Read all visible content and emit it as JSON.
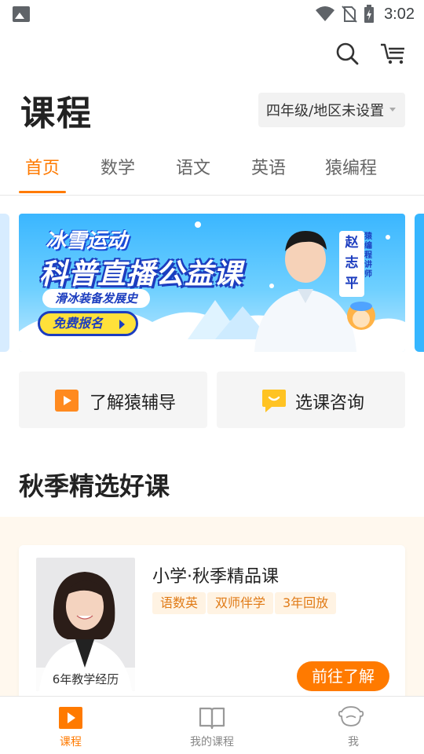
{
  "status_bar": {
    "time": "3:02",
    "icons": [
      "image-notification-icon",
      "wifi-icon",
      "no-sim-icon",
      "battery-charging-icon"
    ]
  },
  "header": {
    "title": "课程",
    "grade_selector": "四年级/地区未设置",
    "actions": [
      "search-icon",
      "cart-icon"
    ]
  },
  "tabs": [
    {
      "label": "首页",
      "active": true
    },
    {
      "label": "数学",
      "active": false
    },
    {
      "label": "语文",
      "active": false
    },
    {
      "label": "英语",
      "active": false
    },
    {
      "label": "猿编程",
      "active": false
    }
  ],
  "banner": {
    "top_line": "冰雪运动",
    "main_line": "科普直播公益课",
    "subtitle": "滑冰装备发展史",
    "cta": "免费报名",
    "teacher_name": "赵志平",
    "teacher_role": "猿编程讲师"
  },
  "quick_actions": [
    {
      "label": "了解猿辅导",
      "icon": "play-icon"
    },
    {
      "label": "选课咨询",
      "icon": "chat-icon"
    }
  ],
  "section": {
    "title": "秋季精选好课",
    "course": {
      "title": "小学·秋季精品课",
      "tags": [
        "语数英",
        "双师伴学",
        "3年回放"
      ],
      "teacher_experience": "6年教学经历",
      "button": "前往了解"
    }
  },
  "bottom_nav": [
    {
      "label": "课程",
      "icon": "play-icon",
      "active": true
    },
    {
      "label": "我的课程",
      "icon": "book-icon",
      "active": false
    },
    {
      "label": "我",
      "icon": "monkey-face-icon",
      "active": false
    }
  ],
  "colors": {
    "accent": "#ff7a00",
    "banner_blue": "#3ab6ff",
    "tag_bg": "#fff3e3"
  }
}
